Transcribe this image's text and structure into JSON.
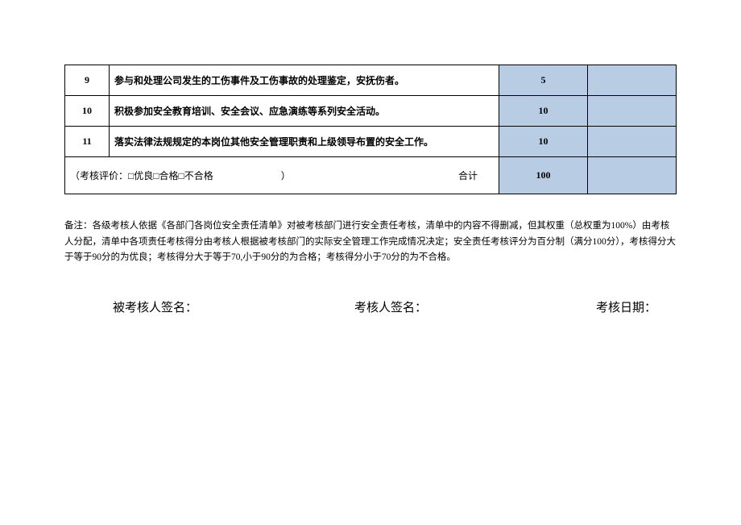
{
  "table": {
    "rows": [
      {
        "num": "9",
        "desc": "参与和处理公司发生的工伤事件及工伤事故的处理鉴定，安抚伤者。",
        "score": "5"
      },
      {
        "num": "10",
        "desc": "积极参加安全教育培训、安全会议、应急演练等系列安全活动。",
        "score": "10"
      },
      {
        "num": "11",
        "desc": "落实法律法规规定的本岗位其他安全管理职责和上级领导布置的安全工作。",
        "score": "10"
      }
    ],
    "evaluation_label": "（考核评价：□优良□合格□不合格　　　　　　　）",
    "total_label": "合计",
    "total_score": "100"
  },
  "note": "备注：各级考核人依据《各部门各岗位安全责任清单》对被考核部门进行安全责任考核，清单中的内容不得删减，但其权重（总权重为100%）由考核人分配，清单中各项责任考核得分由考核人根据被考核部门的实际安全管理工作完成情况决定；安全责任考核评分为百分制（满分100分），考核得分大于等于90分的为优良；考核得分大于等于70,小于90分的为合格；考核得分小于70分的为不合格。",
  "signatures": {
    "assessed": "被考核人签名：",
    "assessor": "考核人签名：",
    "date": "考核日期："
  }
}
